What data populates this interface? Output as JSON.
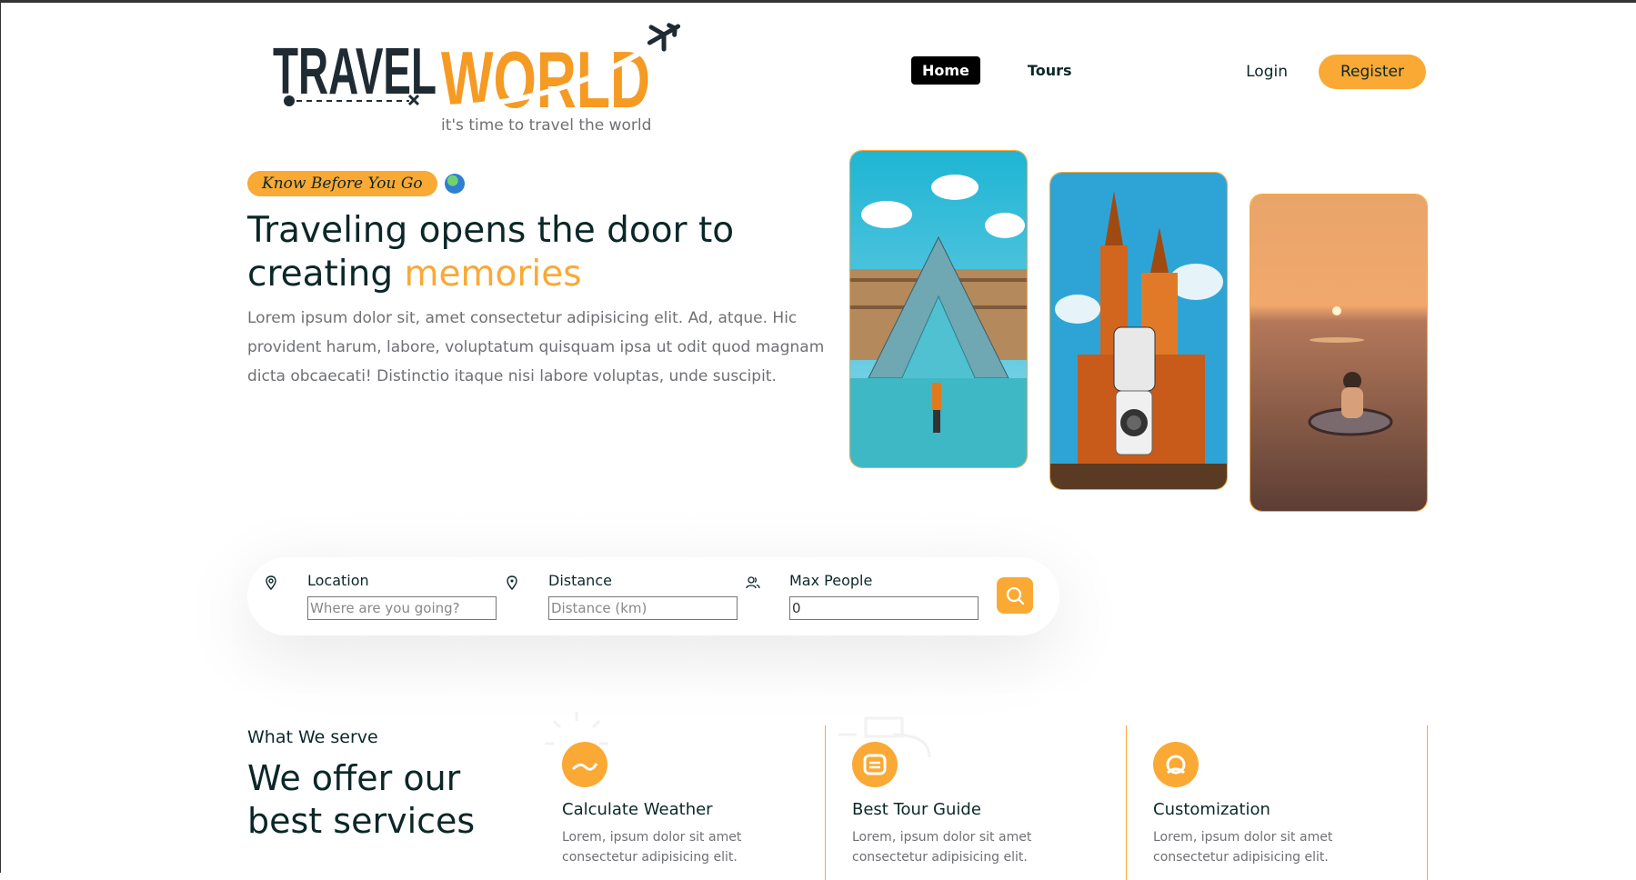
{
  "brand": {
    "logo_text_1": "TRAVEL",
    "logo_text_2": "WORLD",
    "tagline": "it's time to travel the world",
    "accent_color": "#faa935",
    "dark_color": "#0b2727"
  },
  "nav": {
    "items": [
      {
        "label": "Home",
        "active": true
      },
      {
        "label": "Tours",
        "active": false
      }
    ]
  },
  "auth": {
    "login": "Login",
    "register": "Register"
  },
  "hero": {
    "badge": "Know Before You Go",
    "title_part1": "Traveling opens the door to creating ",
    "title_highlight": "memories",
    "description": "Lorem ipsum dolor sit, amet consectetur adipisicing elit. Ad, atque. Hic provident harum, labore, voluptatum quisquam ipsa ut odit quod magnam dicta obcaecati! Distinctio itaque nisi labore voluptas, unde suscipit."
  },
  "search": {
    "fields": [
      {
        "label": "Location",
        "placeholder": "Where are you going?",
        "value": "",
        "icon": "map-pin-icon"
      },
      {
        "label": "Distance",
        "placeholder": "Distance (km)",
        "value": "",
        "icon": "map-pin-distance-icon"
      },
      {
        "label": "Max People",
        "placeholder": "",
        "value": "0",
        "icon": "group-icon"
      }
    ],
    "button_icon": "search-icon"
  },
  "services": {
    "subtitle": "What We serve",
    "title": "We offer our best services",
    "items": [
      {
        "title": "Calculate Weather",
        "description": "Lorem, ipsum dolor sit amet consectetur adipisicing elit.",
        "icon": "weather-icon"
      },
      {
        "title": "Best Tour Guide",
        "description": "Lorem, ipsum dolor sit amet consectetur adipisicing elit.",
        "icon": "tour-guide-icon"
      },
      {
        "title": "Customization",
        "description": "Lorem, ipsum dolor sit amet consectetur adipisicing elit.",
        "icon": "customization-icon"
      }
    ]
  }
}
